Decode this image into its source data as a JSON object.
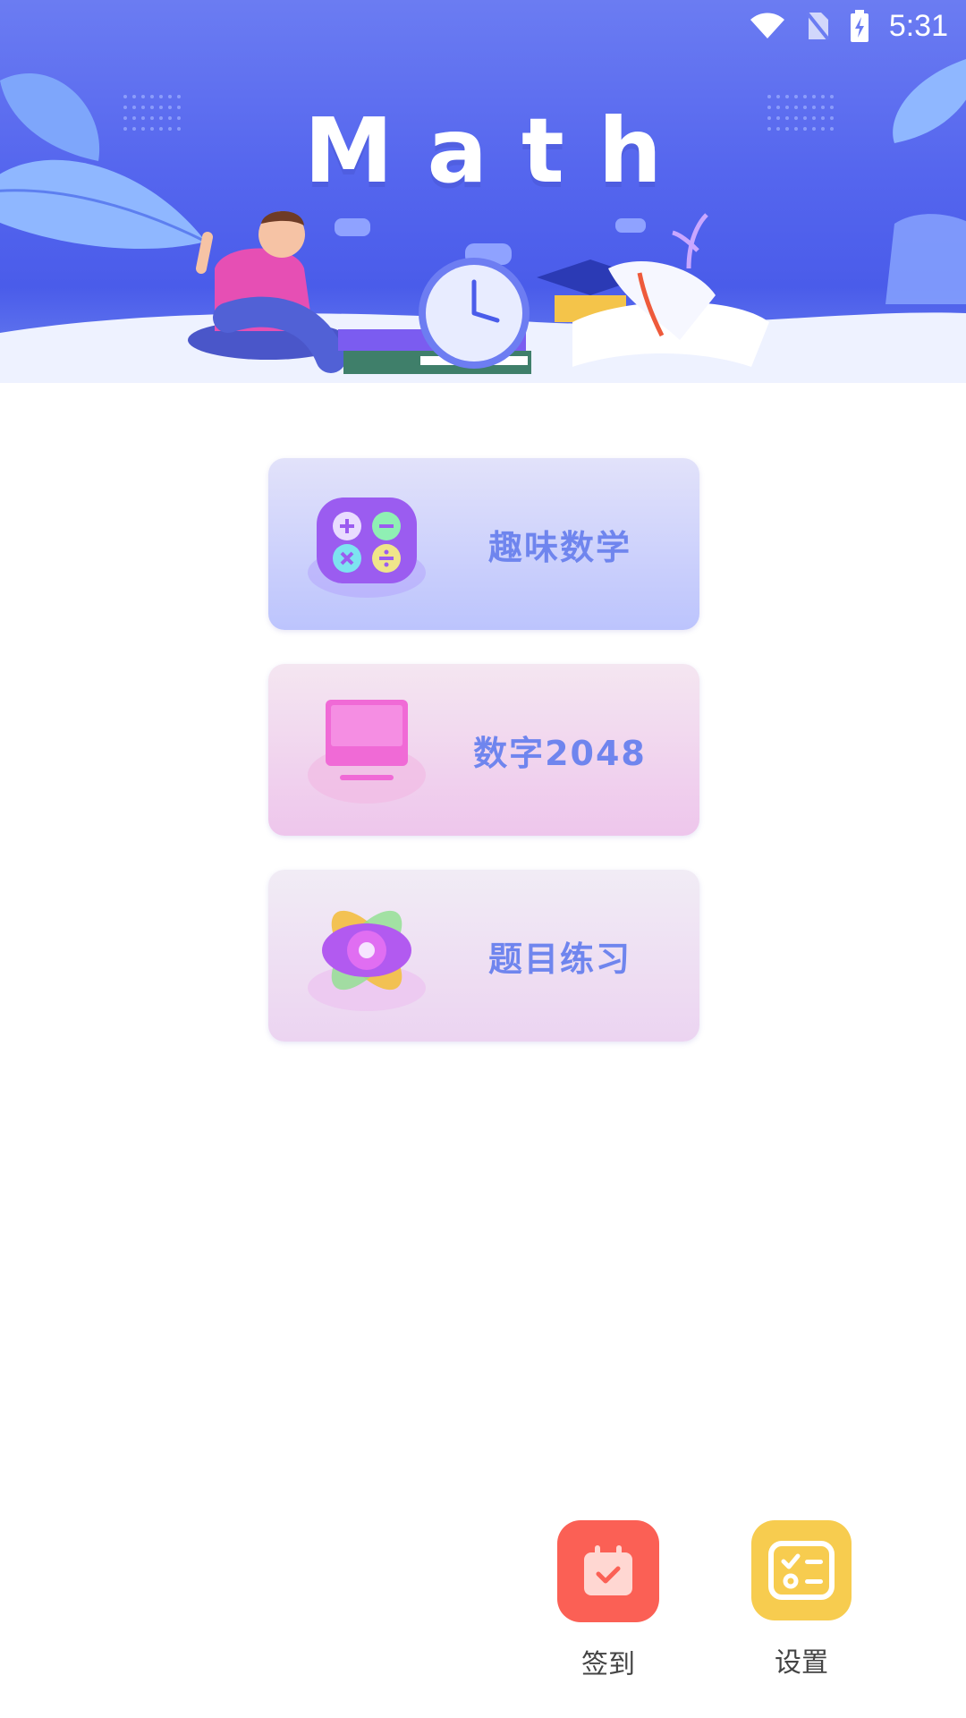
{
  "status_bar": {
    "time": "5:31"
  },
  "banner": {
    "title": "Math"
  },
  "menu": [
    {
      "label": "趣味数学",
      "icon": "calculator-icon"
    },
    {
      "label": "数字2048",
      "icon": "monitor-icon"
    },
    {
      "label": "题目练习",
      "icon": "atom-icon"
    }
  ],
  "actions": {
    "checkin_label": "签到",
    "settings_label": "设置"
  },
  "colors": {
    "accent_text": "#6f85ee",
    "checkin": "#fb6055",
    "settings": "#f7cc4f",
    "banner": "#5566ee"
  }
}
